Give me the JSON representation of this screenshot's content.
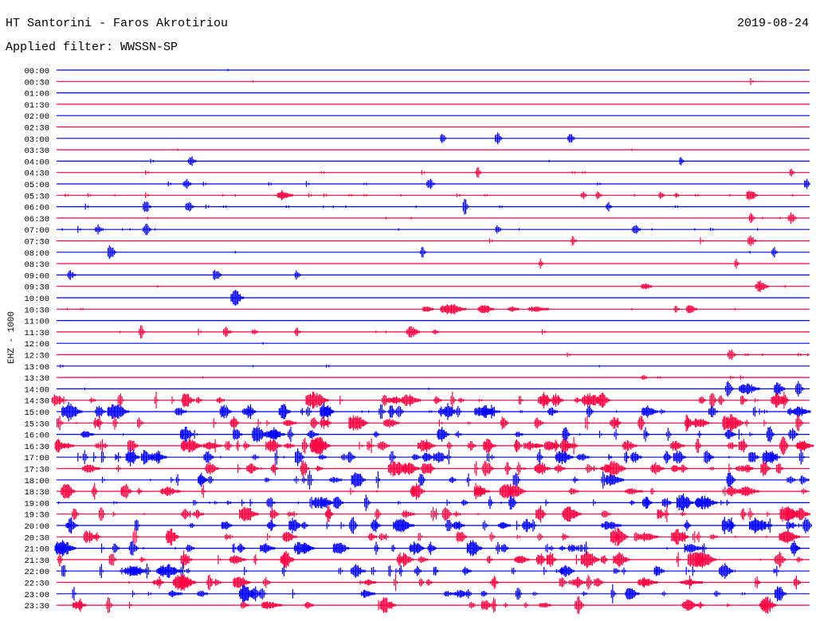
{
  "header": {
    "title": "HT Santorini - Faros Akrotiriou",
    "date": "2019-08-24",
    "filter": "Applied filter: WWSSN-SP"
  },
  "chart_data": {
    "type": "line",
    "subtype": "helicorder",
    "title": "HT Santorini - Faros Akrotiriou",
    "ylabel": "EHZ - 1000",
    "row_minutes": 30,
    "colors": {
      "even": "#0000ff",
      "odd": "#ff0040"
    },
    "note": "events listed as [minute_within_row, relative_amplitude 0-1, duration_minutes]; dense rows give event count",
    "rows": [
      {
        "label": "00:00",
        "events": [
          [
            6.8,
            0.05,
            0.05
          ]
        ]
      },
      {
        "label": "00:30",
        "events": [
          [
            7.8,
            0.2,
            0.05
          ],
          [
            27.7,
            0.8,
            0.1
          ]
        ]
      },
      {
        "label": "01:00",
        "events": []
      },
      {
        "label": "01:30",
        "events": []
      },
      {
        "label": "02:00",
        "events": []
      },
      {
        "label": "02:30",
        "events": []
      },
      {
        "label": "03:00",
        "events": [
          [
            15.4,
            0.7,
            0.2
          ],
          [
            17.6,
            0.6,
            0.25
          ],
          [
            20.5,
            0.6,
            0.25
          ]
        ]
      },
      {
        "label": "03:30",
        "events": [
          [
            4.8,
            0.3,
            0.05
          ],
          [
            22.9,
            0.5,
            0.05
          ]
        ]
      },
      {
        "label": "04:00",
        "events": [
          [
            3.8,
            0.5,
            0.1
          ],
          [
            5.4,
            0.6,
            0.3
          ],
          [
            19.6,
            0.1,
            0.05
          ],
          [
            24.9,
            0.6,
            0.15
          ]
        ]
      },
      {
        "label": "04:30",
        "events": [
          [
            3.6,
            0.5,
            0.1
          ],
          [
            10.6,
            0.4,
            0.1
          ],
          [
            14.6,
            0.5,
            0.1
          ],
          [
            16.8,
            0.6,
            0.2
          ],
          [
            20.6,
            0.3,
            0.1
          ],
          [
            21.0,
            0.2,
            0.1
          ],
          [
            29.3,
            0.6,
            0.15
          ]
        ]
      },
      {
        "label": "05:00",
        "events": [
          [
            4.5,
            0.6,
            0.1
          ],
          [
            5.2,
            0.6,
            0.3
          ],
          [
            5.9,
            0.7,
            0.1
          ],
          [
            8.5,
            0.3,
            0.1
          ],
          [
            10.0,
            0.6,
            0.1
          ],
          [
            12.3,
            0.4,
            0.1
          ],
          [
            14.9,
            0.6,
            0.3
          ],
          [
            21.6,
            0.4,
            0.1
          ],
          [
            29.9,
            0.6,
            0.2
          ]
        ]
      },
      {
        "label": "05:30",
        "events": [
          [
            0.4,
            0.6,
            0.1
          ],
          [
            1.3,
            0.4,
            0.1
          ],
          [
            2.3,
            0.4,
            0.05
          ],
          [
            3.6,
            0.5,
            0.1
          ],
          [
            6.6,
            0.3,
            0.05
          ],
          [
            7.1,
            0.3,
            0.05
          ],
          [
            9.1,
            0.5,
            0.6
          ],
          [
            10.1,
            0.4,
            0.1
          ],
          [
            10.7,
            0.4,
            0.1
          ],
          [
            11.7,
            0.2,
            0.1
          ],
          [
            12.3,
            0.3,
            0.1
          ],
          [
            13.7,
            0.4,
            0.05
          ],
          [
            16.0,
            0.4,
            0.1
          ],
          [
            17.1,
            0.4,
            0.1
          ],
          [
            21.0,
            0.5,
            0.2
          ],
          [
            21.6,
            0.5,
            0.2
          ],
          [
            23.0,
            0.4,
            0.05
          ],
          [
            24.1,
            0.4,
            0.2
          ],
          [
            24.7,
            0.3,
            0.15
          ],
          [
            25.5,
            0.3,
            0.1
          ],
          [
            26.8,
            0.3,
            0.05
          ],
          [
            27.7,
            0.7,
            0.4
          ],
          [
            29.3,
            0.5,
            0.05
          ]
        ]
      },
      {
        "label": "06:00",
        "events": [
          [
            1.2,
            0.7,
            0.1
          ],
          [
            3.6,
            0.7,
            0.3
          ],
          [
            5.3,
            0.6,
            0.3
          ],
          [
            6.0,
            0.4,
            0.1
          ],
          [
            6.7,
            0.3,
            0.1
          ],
          [
            9.2,
            0.3,
            0.1
          ],
          [
            10.6,
            0.3,
            0.05
          ],
          [
            11.0,
            0.3,
            0.05
          ],
          [
            11.5,
            0.2,
            0.05
          ],
          [
            14.3,
            0.3,
            0.05
          ],
          [
            16.3,
            0.8,
            0.2
          ],
          [
            17.7,
            0.3,
            0.1
          ],
          [
            22.0,
            0.6,
            0.2
          ],
          [
            24.7,
            0.1,
            0.1
          ]
        ]
      },
      {
        "label": "06:30",
        "events": [
          [
            3.6,
            0.4,
            0.05
          ],
          [
            13.1,
            0.2,
            0.05
          ],
          [
            14.1,
            0.2,
            0.05
          ],
          [
            27.7,
            0.6,
            0.2
          ],
          [
            28.1,
            0.3,
            0.05
          ],
          [
            28.8,
            0.4,
            0.05
          ],
          [
            29.3,
            0.7,
            0.3
          ]
        ]
      },
      {
        "label": "07:00",
        "events": [
          [
            0.2,
            0.4,
            0.05
          ],
          [
            0.9,
            0.6,
            0.1
          ],
          [
            1.7,
            0.5,
            0.3
          ],
          [
            2.6,
            0.4,
            0.05
          ],
          [
            2.9,
            0.4,
            0.05
          ],
          [
            3.6,
            0.7,
            0.3
          ],
          [
            3.9,
            0.4,
            0.05
          ],
          [
            13.6,
            0.5,
            0.05
          ],
          [
            17.6,
            0.5,
            0.2
          ],
          [
            18.4,
            0.2,
            0.05
          ],
          [
            23.1,
            0.5,
            0.3
          ],
          [
            23.7,
            0.4,
            0.05
          ],
          [
            25.4,
            0.5,
            0.05
          ],
          [
            26.1,
            0.5,
            0.1
          ],
          [
            27.9,
            0.3,
            0.05
          ]
        ]
      },
      {
        "label": "07:30",
        "events": [
          [
            17.3,
            0.7,
            0.1
          ],
          [
            20.6,
            0.5,
            0.2
          ],
          [
            25.7,
            0.6,
            0.1
          ],
          [
            27.7,
            0.6,
            0.3
          ]
        ]
      },
      {
        "label": "08:00",
        "events": [
          [
            2.2,
            0.8,
            0.3
          ],
          [
            7.1,
            0.4,
            0.05
          ],
          [
            14.6,
            0.6,
            0.2
          ],
          [
            27.6,
            0.4,
            0.05
          ],
          [
            28.6,
            0.6,
            0.2
          ]
        ]
      },
      {
        "label": "08:30",
        "events": [
          [
            19.3,
            0.5,
            0.15
          ],
          [
            27.1,
            0.5,
            0.15
          ]
        ]
      },
      {
        "label": "09:00",
        "events": [
          [
            0.6,
            0.5,
            0.3
          ],
          [
            6.4,
            0.7,
            0.3
          ],
          [
            9.6,
            0.5,
            0.2
          ]
        ]
      },
      {
        "label": "09:30",
        "events": [
          [
            4.0,
            0.5,
            0.05
          ],
          [
            23.5,
            0.4,
            0.4
          ],
          [
            28.1,
            0.6,
            0.5
          ],
          [
            29.0,
            0.5,
            0.05
          ]
        ]
      },
      {
        "label": "10:00",
        "events": [
          [
            7.2,
            0.8,
            0.5
          ]
        ]
      },
      {
        "label": "10:30",
        "events": [
          [
            0.4,
            0.7,
            0.05
          ],
          [
            1.0,
            0.2,
            0.1
          ],
          [
            14.8,
            0.4,
            0.4
          ],
          [
            15.8,
            0.6,
            1.0
          ],
          [
            17.1,
            0.5,
            0.6
          ],
          [
            18.2,
            0.3,
            0.4
          ],
          [
            19.2,
            0.3,
            0.8
          ],
          [
            22.9,
            0.6,
            0.05
          ],
          [
            24.7,
            0.4,
            0.2
          ],
          [
            25.3,
            0.5,
            0.4
          ],
          [
            27.0,
            0.5,
            0.05
          ]
        ]
      },
      {
        "label": "11:00",
        "events": []
      },
      {
        "label": "11:30",
        "events": [
          [
            2.5,
            0.1,
            0.05
          ],
          [
            3.4,
            0.7,
            0.2
          ],
          [
            5.7,
            0.6,
            0.1
          ],
          [
            6.8,
            0.5,
            0.3
          ],
          [
            7.9,
            0.4,
            0.2
          ],
          [
            9.6,
            0.5,
            0.2
          ],
          [
            12.7,
            0.3,
            0.05
          ],
          [
            13.1,
            0.4,
            0.05
          ],
          [
            14.2,
            0.6,
            0.5
          ],
          [
            15.1,
            0.3,
            0.2
          ],
          [
            19.4,
            0.5,
            0.1
          ]
        ]
      },
      {
        "label": "12:00",
        "events": [
          [
            8.2,
            0.2,
            0.05
          ]
        ]
      },
      {
        "label": "12:30",
        "events": [
          [
            20.4,
            0.5,
            0.1
          ],
          [
            26.9,
            0.6,
            0.3
          ],
          [
            27.5,
            0.4,
            0.1
          ],
          [
            28.1,
            0.6,
            0.05
          ],
          [
            29.6,
            0.3,
            0.1
          ],
          [
            29.9,
            0.7,
            0.05
          ]
        ]
      },
      {
        "label": "13:00",
        "events": [
          [
            0.2,
            0.4,
            0.1
          ],
          [
            7.8,
            0.6,
            0.05
          ],
          [
            10.8,
            0.4,
            0.1
          ],
          [
            21.6,
            0.4,
            0.05
          ]
        ]
      },
      {
        "label": "13:30",
        "events": [
          [
            5.8,
            0.4,
            0.05
          ],
          [
            23.4,
            0.4,
            0.2
          ],
          [
            24.0,
            0.3,
            0.1
          ],
          [
            26.9,
            0.4,
            0.1
          ],
          [
            27.3,
            0.4,
            0.1
          ]
        ]
      },
      {
        "label": "14:00",
        "events": [
          [
            1.1,
            0.4,
            0.05
          ],
          [
            14.8,
            0.5,
            0.05
          ],
          [
            26.8,
            0.8,
            0.3
          ],
          [
            27.6,
            0.6,
            0.8
          ],
          [
            28.8,
            0.7,
            0.4
          ],
          [
            29.6,
            0.8,
            0.3
          ]
        ]
      },
      {
        "label": "14:30",
        "density": 40
      },
      {
        "label": "15:00",
        "density": 45
      },
      {
        "label": "15:30",
        "density": 35
      },
      {
        "label": "16:00",
        "density": 30
      },
      {
        "label": "16:30",
        "density": 50
      },
      {
        "label": "17:00",
        "density": 45
      },
      {
        "label": "17:30",
        "density": 35
      },
      {
        "label": "18:00",
        "density": 25
      },
      {
        "label": "18:30",
        "density": 25
      },
      {
        "label": "19:00",
        "density": 35
      },
      {
        "label": "19:30",
        "density": 35
      },
      {
        "label": "20:00",
        "density": 35
      },
      {
        "label": "20:30",
        "density": 30
      },
      {
        "label": "21:00",
        "density": 35
      },
      {
        "label": "21:30",
        "density": 30
      },
      {
        "label": "22:00",
        "density": 40
      },
      {
        "label": "22:30",
        "density": 30
      },
      {
        "label": "23:00",
        "density": 25
      },
      {
        "label": "23:30",
        "density": 25
      }
    ]
  }
}
